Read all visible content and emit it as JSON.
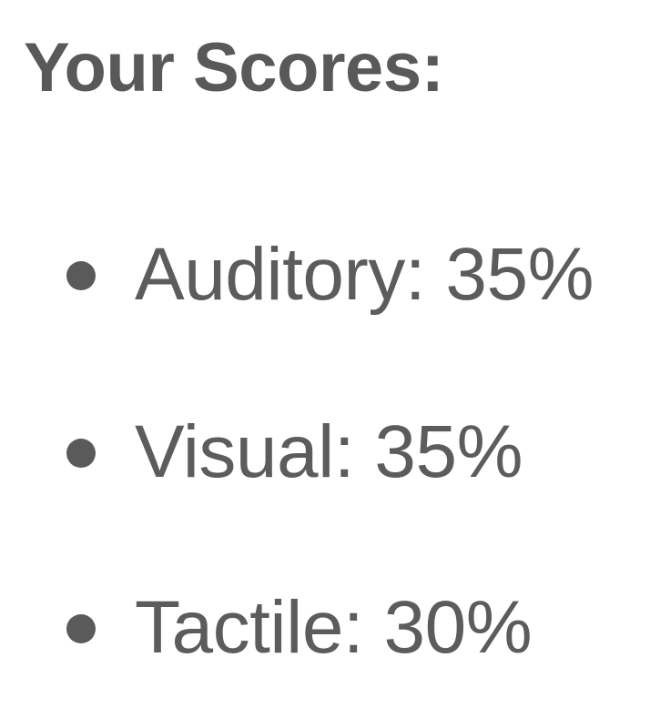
{
  "heading": "Your Scores:",
  "scores": [
    {
      "text": "Auditory: 35%",
      "category": "Auditory",
      "percent": 35
    },
    {
      "text": "Visual: 35%",
      "category": "Visual",
      "percent": 35
    },
    {
      "text": "Tactile: 30%",
      "category": "Tactile",
      "percent": 30
    }
  ],
  "colors": {
    "text": "#5a5a5a",
    "background": "#ffffff"
  }
}
